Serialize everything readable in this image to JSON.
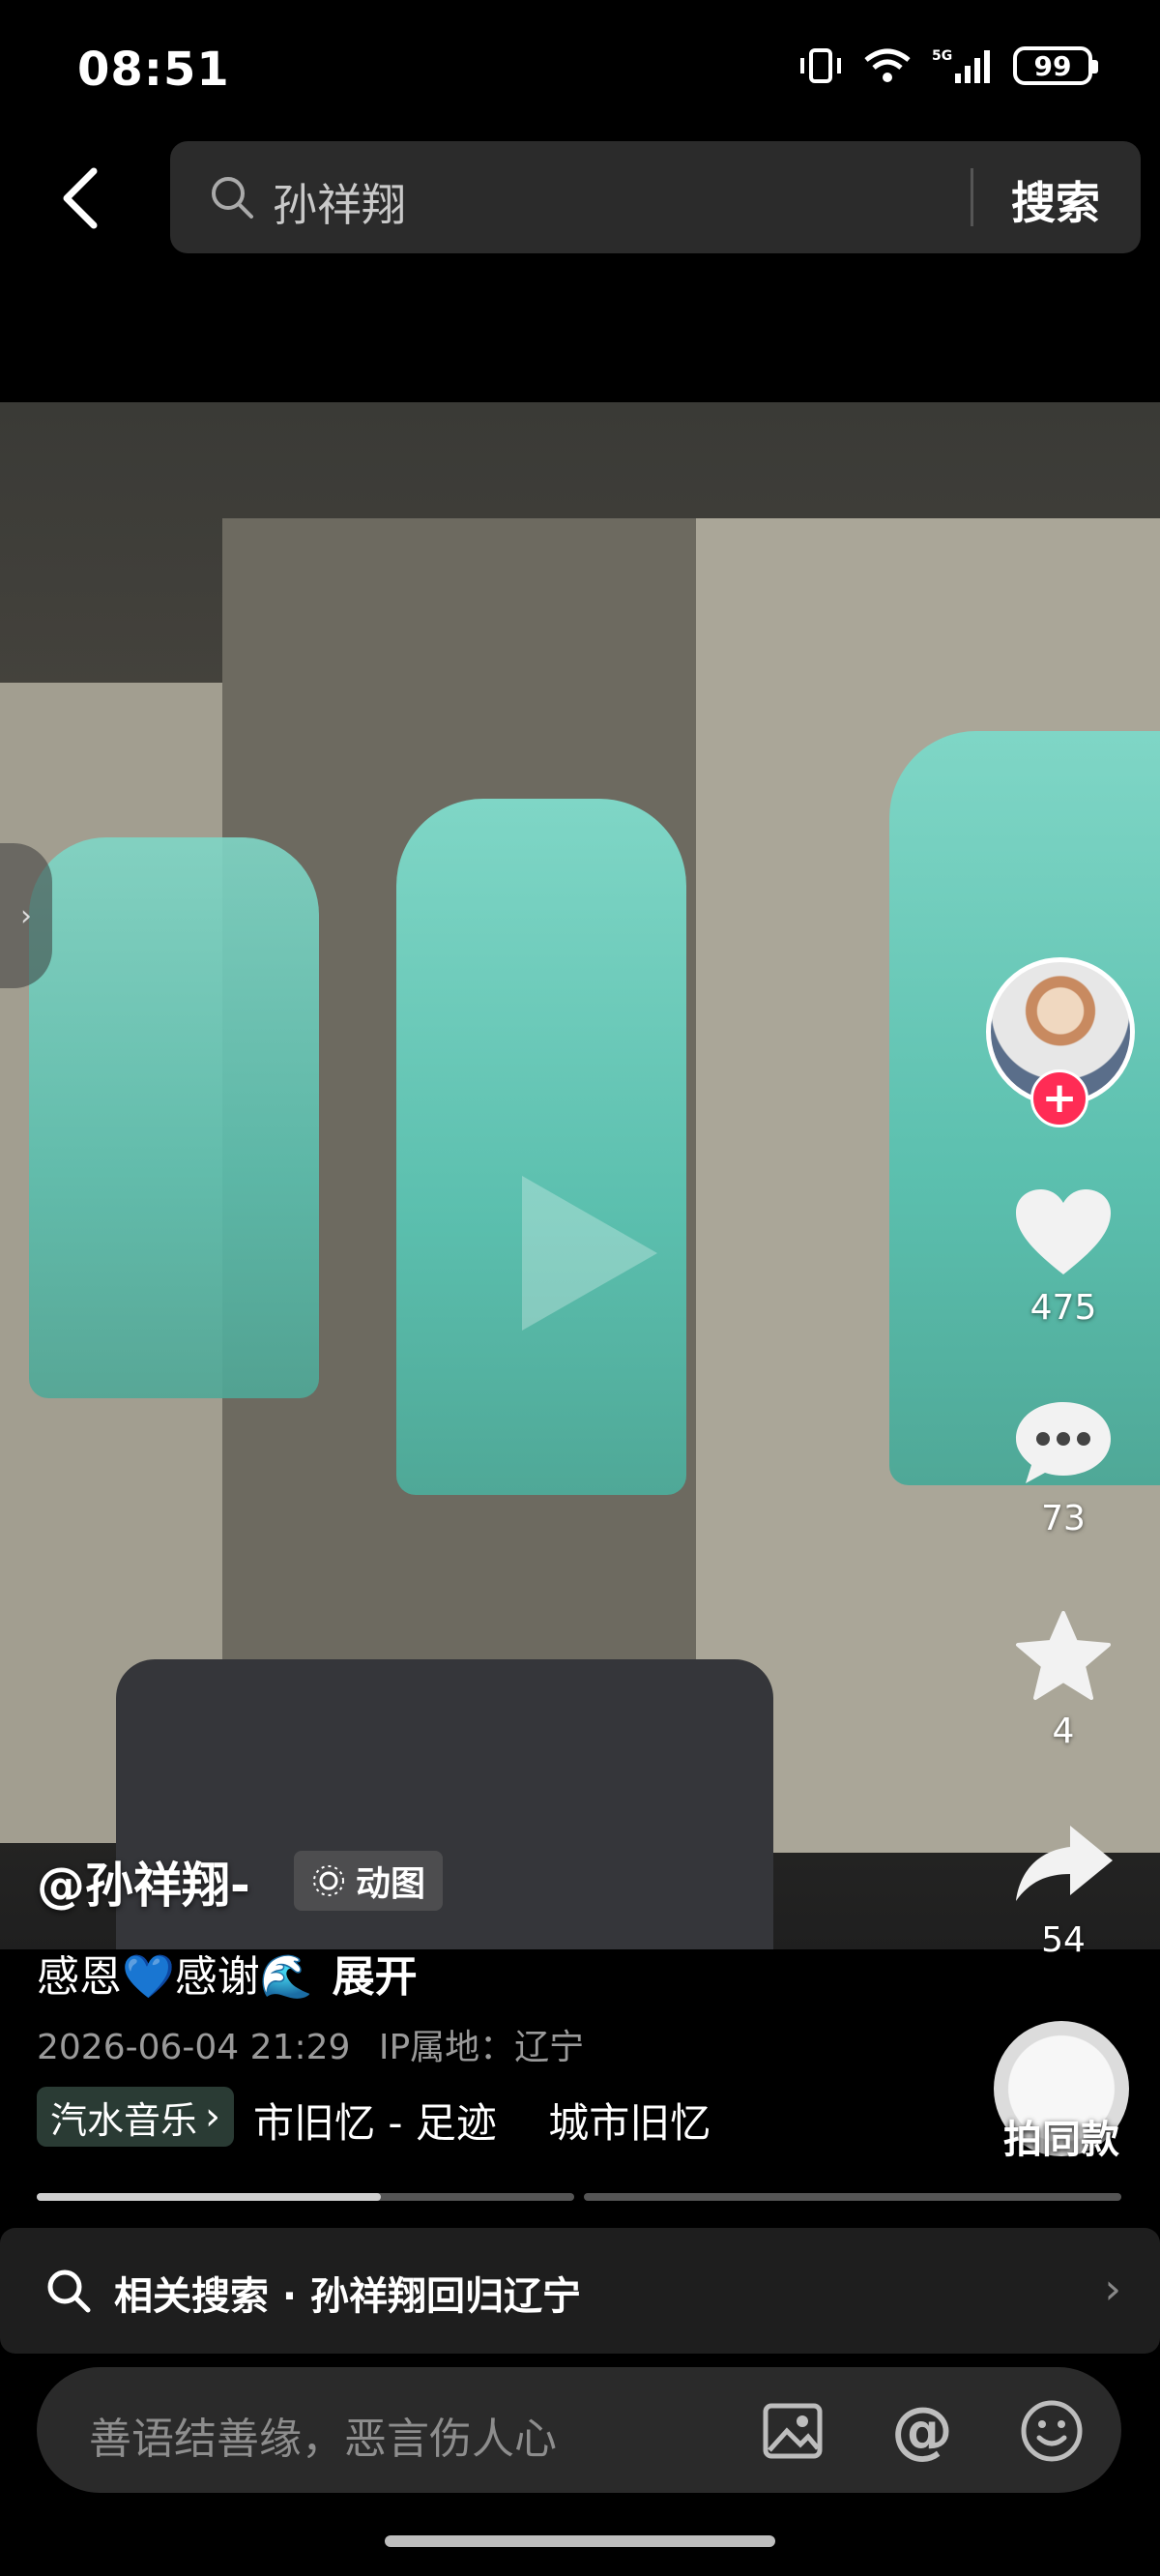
{
  "status_bar": {
    "time": "08:51",
    "battery": "99",
    "network": "5G"
  },
  "search": {
    "query": "孙祥翔",
    "button_label": "搜索"
  },
  "video": {
    "author": "@孙祥翔-",
    "badge": "动图",
    "caption": "感恩💙感谢🌊",
    "expand_label": "展开",
    "datetime": "2026-06-04 21:29",
    "ip_location": "IP属地：辽宁",
    "music_tag": "汽水音乐",
    "music_title": "市旧忆 - 足迹    城市旧忆",
    "same_style_label": "拍同款",
    "progress": [
      0.64,
      0.0
    ]
  },
  "actions": {
    "likes": "475",
    "comments": "73",
    "favorites": "4",
    "shares": "54"
  },
  "related": {
    "label": "相关搜索 · 孙祥翔回归辽宁"
  },
  "comment_bar": {
    "placeholder": "善语结善缘，恶言伤人心"
  },
  "colors": {
    "follow": "#ff2c55",
    "music_tag_bg": "#2a3b34",
    "jersey": "#5bbfae"
  }
}
